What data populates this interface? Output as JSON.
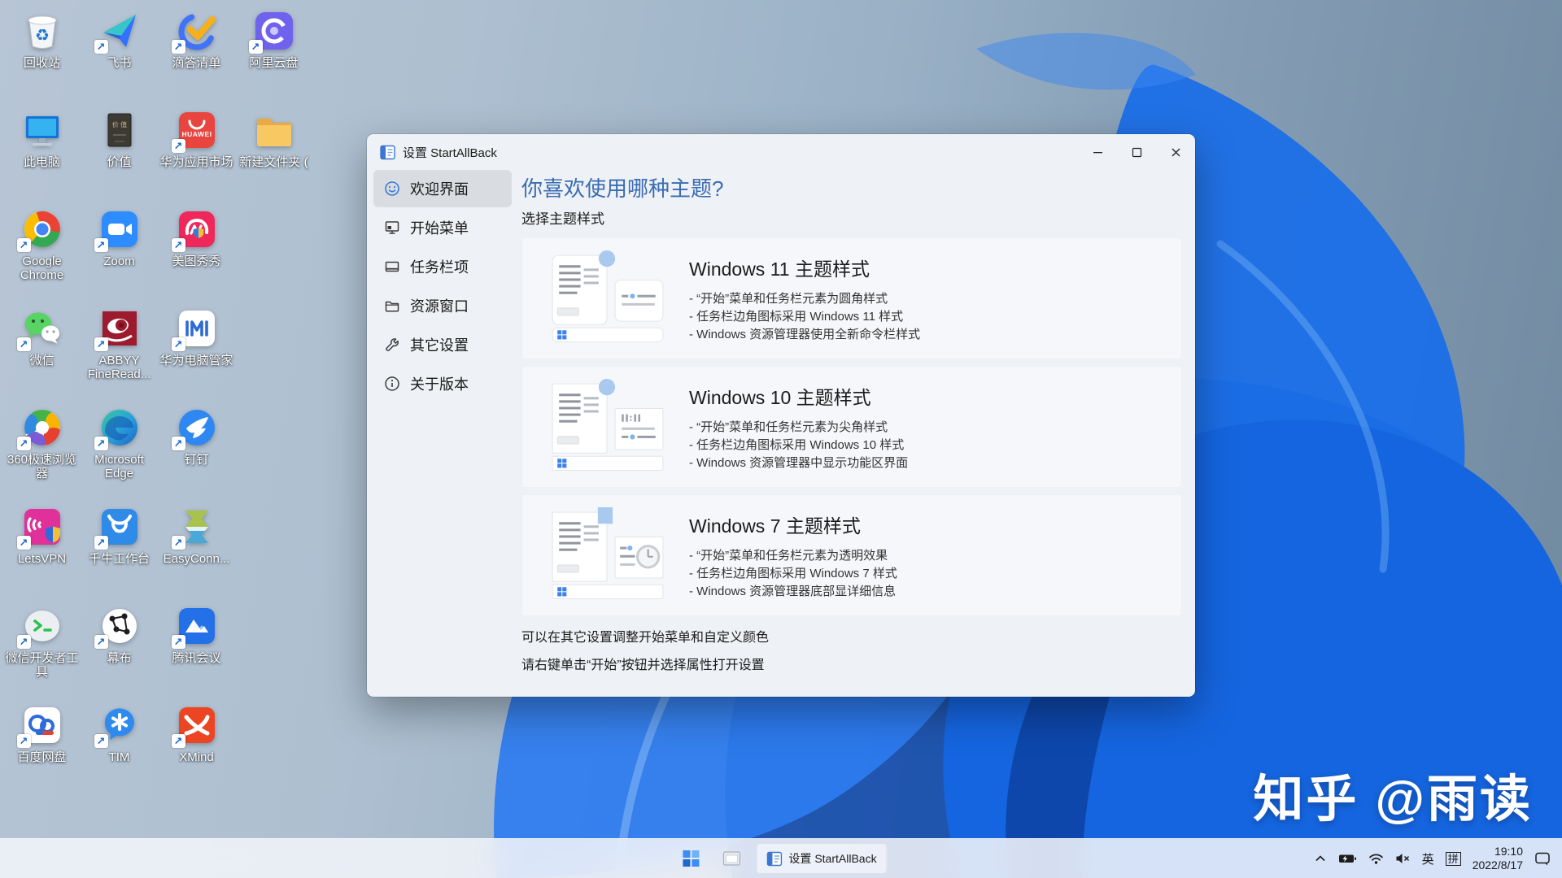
{
  "desktop": {
    "watermark": "知乎 @雨读",
    "icons": [
      {
        "id": "recycle-bin",
        "label": "回收站",
        "shortcut": false
      },
      {
        "id": "this-pc",
        "label": "此电脑",
        "shortcut": false
      },
      {
        "id": "chrome",
        "label": "Google Chrome",
        "shortcut": true
      },
      {
        "id": "wechat",
        "label": "微信",
        "shortcut": true
      },
      {
        "id": "browser-360",
        "label": "360极速浏览器",
        "shortcut": true
      },
      {
        "id": "letsvpn",
        "label": "LetsVPN",
        "shortcut": true
      },
      {
        "id": "wechat-devtools",
        "label": "微信开发者工具",
        "shortcut": true
      },
      {
        "id": "baidu-netdisk",
        "label": "百度网盘",
        "shortcut": true
      },
      {
        "id": "feishu",
        "label": "飞书",
        "shortcut": true
      },
      {
        "id": "book-jiazhi",
        "label": "价值",
        "shortcut": false
      },
      {
        "id": "zoom-app",
        "label": "Zoom",
        "shortcut": true
      },
      {
        "id": "abbyy",
        "label": "ABBYY FineRead...",
        "shortcut": true
      },
      {
        "id": "edge",
        "label": "Microsoft Edge",
        "shortcut": true
      },
      {
        "id": "qianniu",
        "label": "千牛工作台",
        "shortcut": true
      },
      {
        "id": "mubu",
        "label": "幕布",
        "shortcut": true
      },
      {
        "id": "tim",
        "label": "TIM",
        "shortcut": true
      },
      {
        "id": "ticktick",
        "label": "滴答清单",
        "shortcut": true
      },
      {
        "id": "huawei-appgallery",
        "label": "华为应用市场",
        "shortcut": true
      },
      {
        "id": "meitu",
        "label": "美图秀秀",
        "shortcut": true
      },
      {
        "id": "huawei-pc-manager",
        "label": "华为电脑管家",
        "shortcut": true
      },
      {
        "id": "dingtalk",
        "label": "钉钉",
        "shortcut": true
      },
      {
        "id": "easyconnect",
        "label": "EasyConn...",
        "shortcut": true
      },
      {
        "id": "tencent-meeting",
        "label": "腾讯会议",
        "shortcut": true
      },
      {
        "id": "xmind",
        "label": "XMind",
        "shortcut": true
      },
      {
        "id": "aliyun-drive",
        "label": "阿里云盘",
        "shortcut": true
      },
      {
        "id": "new-folder",
        "label": "新建文件夹 (",
        "shortcut": false
      }
    ]
  },
  "window": {
    "title": "设置 StartAllBack",
    "heading": "你喜欢使用哪种主题?",
    "subheading": "选择主题样式",
    "sidebar": [
      {
        "id": "welcome",
        "label": "欢迎界面",
        "icon": "smiley-icon",
        "selected": true
      },
      {
        "id": "start-menu",
        "label": "开始菜单",
        "icon": "start-menu-icon",
        "selected": false
      },
      {
        "id": "taskbar",
        "label": "任务栏项",
        "icon": "taskbar-icon",
        "selected": false
      },
      {
        "id": "explorer",
        "label": "资源窗口",
        "icon": "folder-icon",
        "selected": false
      },
      {
        "id": "advanced",
        "label": "其它设置",
        "icon": "wrench-icon",
        "selected": false
      },
      {
        "id": "about",
        "label": "关于版本",
        "icon": "info-icon",
        "selected": false
      }
    ],
    "themes": [
      {
        "title": "Windows 11 主题样式",
        "bullets": [
          "- “开始”菜单和任务栏元素为圆角样式",
          "- 任务栏边角图标采用 Windows 11 样式",
          "- Windows 资源管理器使用全新命令栏样式"
        ]
      },
      {
        "title": "Windows 10 主题样式",
        "bullets": [
          "- “开始”菜单和任务栏元素为尖角样式",
          "- 任务栏边角图标采用 Windows 10 样式",
          "- Windows 资源管理器中显示功能区界面"
        ]
      },
      {
        "title": "Windows 7 主题样式",
        "bullets": [
          "- “开始”菜单和任务栏元素为透明效果",
          "- 任务栏边角图标采用 Windows 7 样式",
          "- Windows 资源管理器底部显详细信息"
        ]
      }
    ],
    "footnotes": [
      "可以在其它设置调整开始菜单和自定义颜色",
      "请右键单击“开始”按钮并选择属性打开设置"
    ]
  },
  "taskbar": {
    "task_button": "设置 StartAllBack",
    "tray": {
      "lang_primary": "英",
      "lang_ime": "拼",
      "time": "19:10",
      "date": "2022/8/17"
    }
  },
  "colors": {
    "accent_blue": "#1668e0",
    "heading_blue": "#3a6cb4",
    "window_bg": "#eef1f5",
    "card_bg": "#f6f7fa",
    "selected_item_bg": "#d9dde2"
  }
}
